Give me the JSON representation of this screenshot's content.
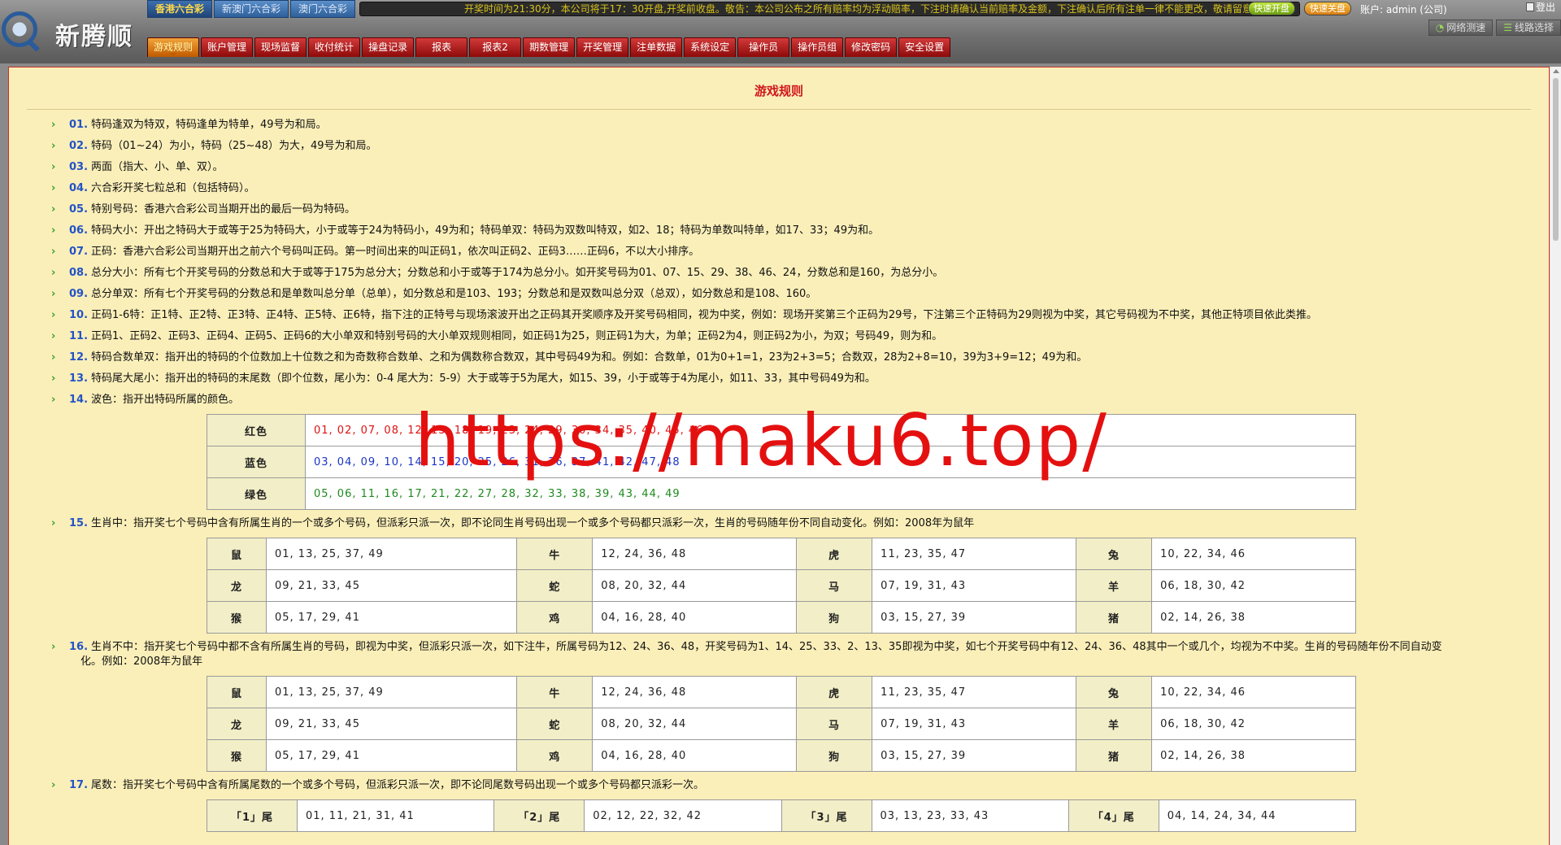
{
  "header": {
    "logo_text": "新腾顺",
    "lottery_tabs": [
      "香港六合彩",
      "新澳门六合彩",
      "澳门六合彩"
    ],
    "marquee": "开奖时间为21:30分，本公司将于17：30开盘,开奖前收盘。敬告：本公司公布之所有赔率均为浮动赔率，下注时请确认当前赔率及金额，下注确认后所有注单一律不能更改，敬请留意",
    "quick_open": "快速开盘",
    "quick_close": "快速关盘",
    "account": "账户: admin (公司)",
    "logout": "登出",
    "tools": [
      {
        "icon": "speed-icon",
        "label": "网络测速"
      },
      {
        "icon": "list-icon",
        "label": "线路选择"
      }
    ],
    "nav": [
      "游戏规则",
      "账户管理",
      "现场监督",
      "收付统计",
      "操盘记录",
      "报表",
      "报表2",
      "期数管理",
      "开奖管理",
      "注单数据",
      "系统设定",
      "操作员",
      "操作员组",
      "修改密码",
      "安全设置"
    ],
    "nav_active": 0
  },
  "panel": {
    "title": "游戏规则"
  },
  "rules": [
    {
      "num": "01.",
      "text": "特码逢双为特双，特码逢单为特单，49号为和局。"
    },
    {
      "num": "02.",
      "text": "特码（01~24）为小，特码（25~48）为大，49号为和局。"
    },
    {
      "num": "03.",
      "text": "两面（指大、小、单、双）。"
    },
    {
      "num": "04.",
      "text": "六合彩开奖七粒总和（包括特码）。"
    },
    {
      "num": "05.",
      "text": "特别号码：香港六合彩公司当期开出的最后一码为特码。"
    },
    {
      "num": "06.",
      "text": "特码大小：开出之特码大于或等于25为特码大，小于或等于24为特码小，49为和；特码单双：特码为双数叫特双，如2、18；特码为单数叫特单，如17、33；49为和。"
    },
    {
      "num": "07.",
      "text": "正码：香港六合彩公司当期开出之前六个号码叫正码。第一时间出来的叫正码1，依次叫正码2、正码3……正码6，不以大小排序。"
    },
    {
      "num": "08.",
      "text": "总分大小：所有七个开奖号码的分数总和大于或等于175为总分大；分数总和小于或等于174为总分小。如开奖号码为01、07、15、29、38、46、24，分数总和是160，为总分小。"
    },
    {
      "num": "09.",
      "text": "总分单双：所有七个开奖号码的分数总和是单数叫总分单（总单），如分数总和是103、193；分数总和是双数叫总分双（总双），如分数总和是108、160。"
    },
    {
      "num": "10.",
      "text": "正码1-6特：正1特、正2特、正3特、正4特、正5特、正6特，指下注的正特号与现场滚波开出之正码其开奖顺序及开奖号码相同，视为中奖，例如：现场开奖第三个正码为29号，下注第三个正特码为29则视为中奖，其它号码视为不中奖，其他正特项目依此类推。"
    },
    {
      "num": "11.",
      "text": "正码1、正码2、正码3、正码4、正码5、正码6的大小单双和特别号码的大小单双规则相同，如正码1为25，则正码1为大，为单；正码2为4，则正码2为小，为双；号码49，则为和。"
    },
    {
      "num": "12.",
      "text": "特码合数单双：指开出的特码的个位数加上十位数之和为奇数称合数单、之和为偶数称合数双，其中号码49为和。例如：合数单，01为0+1=1，23为2+3=5；合数双，28为2+8=10，39为3+9=12；49为和。"
    },
    {
      "num": "13.",
      "text": "特码尾大尾小：指开出的特码的末尾数（即个位数，尾小为：0-4 尾大为：5-9）大于或等于5为尾大，如15、39，小于或等于4为尾小，如11、33，其中号码49为和。"
    },
    {
      "num": "14.",
      "text": "波色：指开出特码所属的颜色。"
    }
  ],
  "color_table": [
    {
      "label": "红色",
      "numbers": "01, 02, 07, 08, 12, 13, 18, 19, 23, 24, 29, 30, 34, 35, 40, 45, 46",
      "cls": "color-red"
    },
    {
      "label": "蓝色",
      "numbers": "03, 04, 09, 10, 14, 15, 20, 25, 26, 31, 36, 37, 41, 42, 47, 48",
      "cls": "color-blue"
    },
    {
      "label": "绿色",
      "numbers": "05, 06, 11, 16, 17, 21, 22, 27, 28, 32, 33, 38, 39, 43, 44, 49",
      "cls": "color-green"
    }
  ],
  "rule15": {
    "num": "15.",
    "text": "生肖中：指开奖七个号码中含有所属生肖的一个或多个号码，但派彩只派一次，即不论同生肖号码出现一个或多个号码都只派彩一次，生肖的号码随年份不同自动变化。例如：2008年为鼠年"
  },
  "rule16": {
    "num": "16.",
    "text": "生肖不中：指开奖七个号码中都不含有所属生肖的号码，即视为中奖，但派彩只派一次，如下注牛，所属号码为12、24、36、48，开奖号码为1、14、25、33、2、13、35即视为中奖，如七个开奖号码中有12、24、36、48其中一个或几个，均视为不中奖。生肖的号码随年份不同自动变化。例如：2008年为鼠年"
  },
  "rule17": {
    "num": "17.",
    "text": "尾数：指开奖七个号码中含有所属尾数的一个或多个号码，但派彩只派一次，即不论同尾数号码出现一个或多个号码都只派彩一次。"
  },
  "zodiac_table": [
    [
      [
        "鼠",
        "01, 13, 25, 37, 49"
      ],
      [
        "牛",
        "12, 24, 36, 48"
      ],
      [
        "虎",
        "11, 23, 35, 47"
      ],
      [
        "兔",
        "10, 22, 34, 46"
      ]
    ],
    [
      [
        "龙",
        "09, 21, 33, 45"
      ],
      [
        "蛇",
        "08, 20, 32, 44"
      ],
      [
        "马",
        "07, 19, 31, 43"
      ],
      [
        "羊",
        "06, 18, 30, 42"
      ]
    ],
    [
      [
        "猴",
        "05, 17, 29, 41"
      ],
      [
        "鸡",
        "04, 16, 28, 40"
      ],
      [
        "狗",
        "03, 15, 27, 39"
      ],
      [
        "猪",
        "02, 14, 26, 38"
      ]
    ]
  ],
  "tail_table": [
    [
      [
        "「1」尾",
        "01, 11, 21, 31, 41"
      ],
      [
        "「2」尾",
        "02, 12, 22, 32, 42"
      ],
      [
        "「3」尾",
        "03, 13, 23, 33, 43"
      ],
      [
        "「4」尾",
        "04, 14, 24, 34, 44"
      ]
    ]
  ],
  "watermark": "https://maku6.top/"
}
